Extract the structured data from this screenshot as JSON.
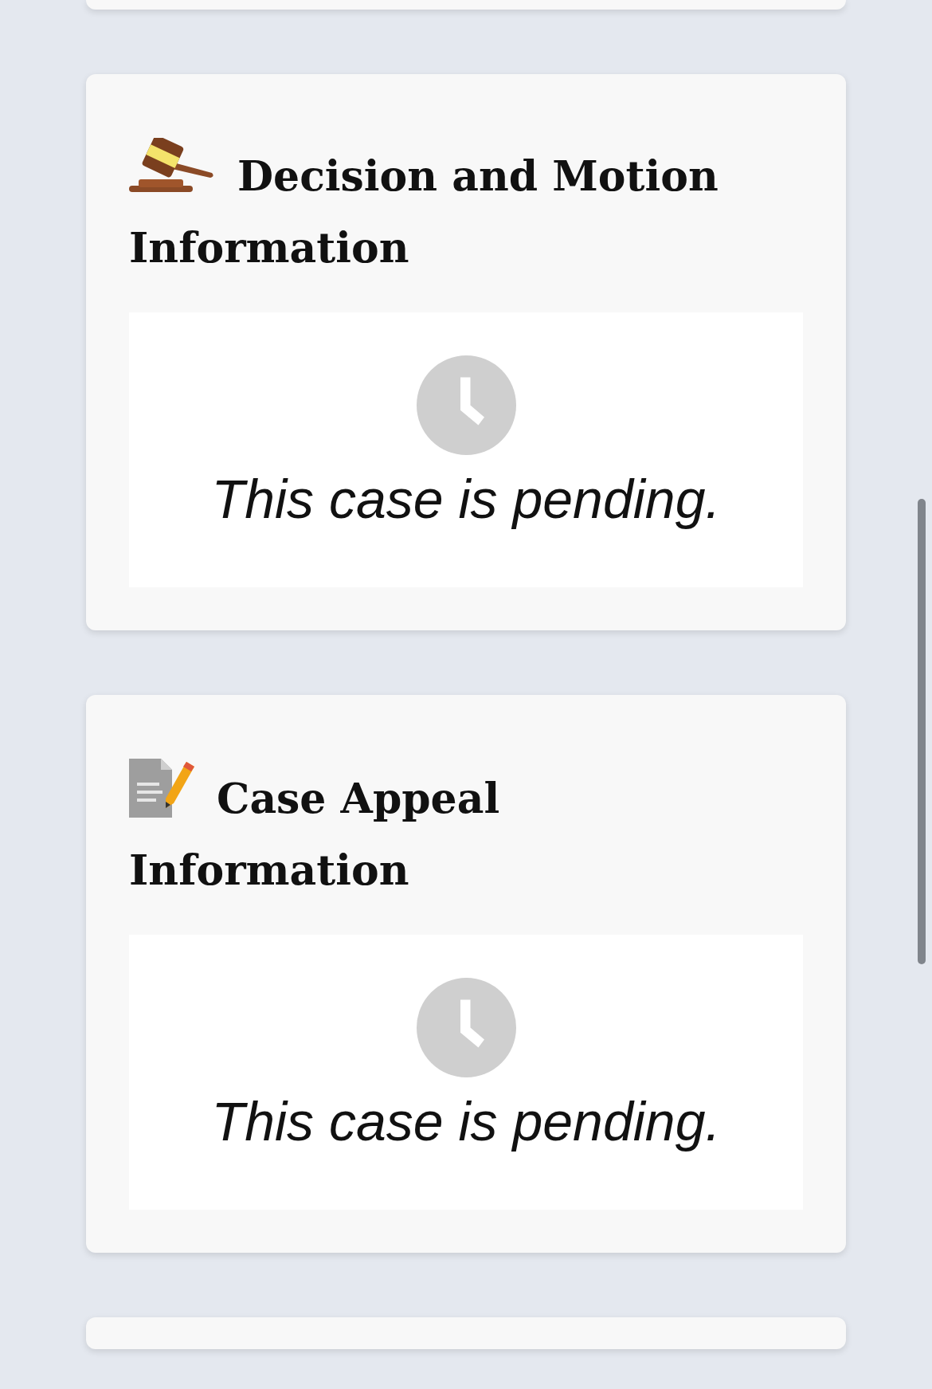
{
  "sections": [
    {
      "kind": "gavel",
      "title_lines": [
        "Decision and Motion",
        "Information"
      ],
      "status": "This case is pending."
    },
    {
      "kind": "memo",
      "title_lines": [
        "Case Appeal",
        "Information"
      ],
      "status": "This case is pending."
    }
  ]
}
